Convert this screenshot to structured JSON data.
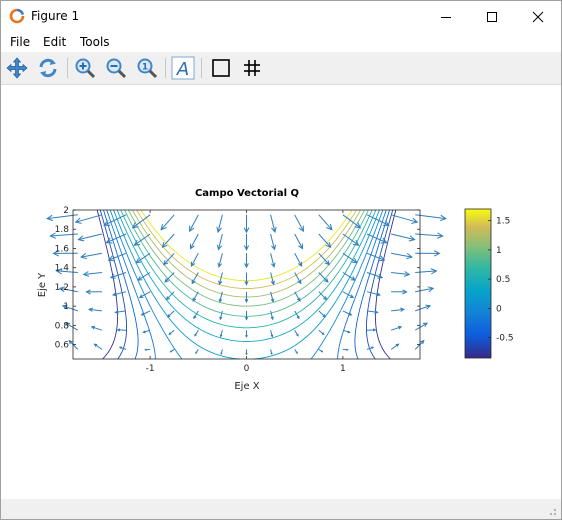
{
  "window": {
    "title": "Figure 1",
    "app_icon": "matlab-logo-icon"
  },
  "menu": {
    "items": [
      "File",
      "Edit",
      "Tools"
    ]
  },
  "toolbar": {
    "buttons": [
      "pan-icon",
      "rotate-icon",
      "zoom-in-icon",
      "zoom-out-icon",
      "zoom-reset-icon",
      "insert-text-icon",
      "box-icon",
      "grid-icon"
    ]
  },
  "chart_data": {
    "type": "quiver",
    "title": "Campo Vectorial Q",
    "xlabel": "Eje X",
    "ylabel": "Eje Y",
    "xlim": [
      -1.8,
      1.8
    ],
    "ylim": [
      0.45,
      2.0
    ],
    "xticks": [
      -1,
      0,
      1
    ],
    "xtick_labels": [
      "-1",
      "0",
      "1"
    ],
    "yticks": [
      0.6,
      0.8,
      1.0,
      1.2,
      1.4,
      1.6,
      1.8,
      2.0
    ],
    "ytick_labels": [
      "0.6",
      "0.8",
      "1",
      "1.2",
      "1.4",
      "1.6",
      "1.8",
      "2"
    ],
    "vector_color": "#2e7ebd",
    "contour_levels": [
      -0.8,
      -0.6,
      -0.4,
      -0.2,
      0.0,
      0.2,
      0.4,
      0.6,
      0.8,
      1.0,
      1.2,
      1.4,
      1.6
    ],
    "colorbar": {
      "min": -0.85,
      "max": 1.7,
      "ticks": [
        -0.5,
        0,
        0.5,
        1,
        1.5
      ],
      "tick_labels": [
        "-0.5",
        "0",
        "0.5",
        "1",
        "1.5"
      ],
      "colormap": "parula"
    }
  }
}
